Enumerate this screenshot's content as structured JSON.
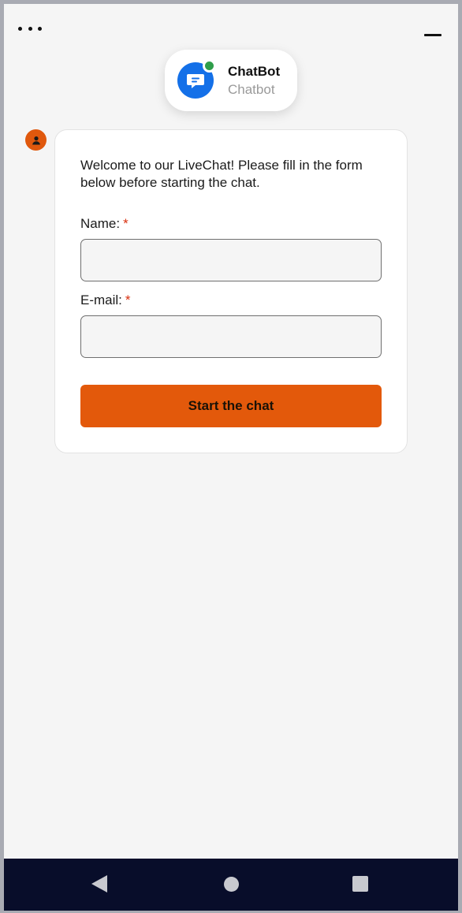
{
  "header": {
    "menu_icon": "more-horizontal-icon",
    "minimize_icon": "minimize-icon"
  },
  "agent": {
    "name": "ChatBot",
    "subtitle": "Chatbot",
    "status_color": "#2f9e4a",
    "avatar_color": "#1470e8",
    "avatar_icon": "chat-bubble-icon"
  },
  "message": {
    "avatar_color": "#e0580d",
    "avatar_icon": "user-icon",
    "welcome_text": "Welcome to our LiveChat! Please fill in the form below before starting the chat."
  },
  "form": {
    "name_label": "Name:",
    "name_value": "",
    "email_label": "E-mail:",
    "email_value": "",
    "required_marker": "*",
    "submit_label": "Start the chat",
    "accent_color": "#e3590b"
  },
  "navbar": {
    "back_icon": "back-triangle-icon",
    "home_icon": "home-circle-icon",
    "recents_icon": "recents-square-icon"
  }
}
